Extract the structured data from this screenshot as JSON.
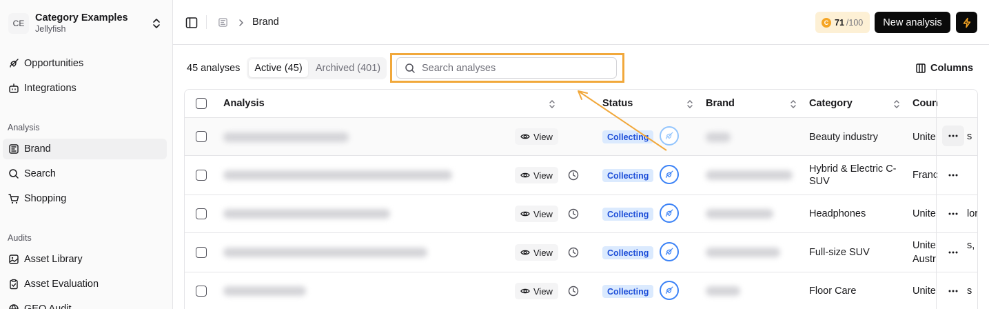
{
  "sidebar": {
    "org": {
      "initials": "CE",
      "name": "Category Examples",
      "subtitle": "Jellyfish"
    },
    "top_items": [
      {
        "label": "Opportunities",
        "icon": "rocket-icon"
      },
      {
        "label": "Integrations",
        "icon": "bot-icon"
      }
    ],
    "analysis_label": "Analysis",
    "analysis_items": [
      {
        "label": "Brand",
        "icon": "layout-icon",
        "active": true
      },
      {
        "label": "Search",
        "icon": "search-icon"
      },
      {
        "label": "Shopping",
        "icon": "cart-icon"
      }
    ],
    "audits_label": "Audits",
    "audit_items": [
      {
        "label": "Asset Library",
        "icon": "image-icon"
      },
      {
        "label": "Asset Evaluation",
        "icon": "clipboard-check-icon"
      },
      {
        "label": "GEO Audit",
        "icon": "globe-icon"
      }
    ]
  },
  "header": {
    "breadcrumb": "Brand",
    "credits_used": "71",
    "credits_total": "/100",
    "credits_coin": "C",
    "new_analysis_label": "New analysis"
  },
  "toolbar": {
    "count_label": "45 analyses",
    "tab_active": "Active (45)",
    "tab_archived": "Archived (401)",
    "search_placeholder": "Search analyses",
    "columns_label": "Columns"
  },
  "table": {
    "headers": {
      "analysis": "Analysis",
      "status": "Status",
      "brand": "Brand",
      "category": "Category",
      "country": "Coun"
    },
    "view_label": "View",
    "rows": [
      {
        "status": "Collecting",
        "category": "Beauty industry",
        "country": "Unite",
        "peek": "s",
        "has_clock": false
      },
      {
        "status": "Collecting",
        "category": "Hybrid & Electric C-SUV",
        "country": "Franc",
        "peek": "",
        "has_clock": true
      },
      {
        "status": "Collecting",
        "category": "Headphones",
        "country": "Unite",
        "peek": "lor",
        "has_clock": true
      },
      {
        "status": "Collecting",
        "category": "Full-size SUV",
        "country": "Unite",
        "country_line2": "Austr",
        "peek": "s,",
        "has_clock": true
      },
      {
        "status": "Collecting",
        "category": "Floor Care",
        "country": "Unite",
        "peek": "s",
        "has_clock": true
      }
    ]
  },
  "colors": {
    "accent_highlight": "#f1a83b",
    "status_bg": "#dbeafe",
    "status_text": "#1d4ed8",
    "credits_bg": "#fdf0d5"
  }
}
